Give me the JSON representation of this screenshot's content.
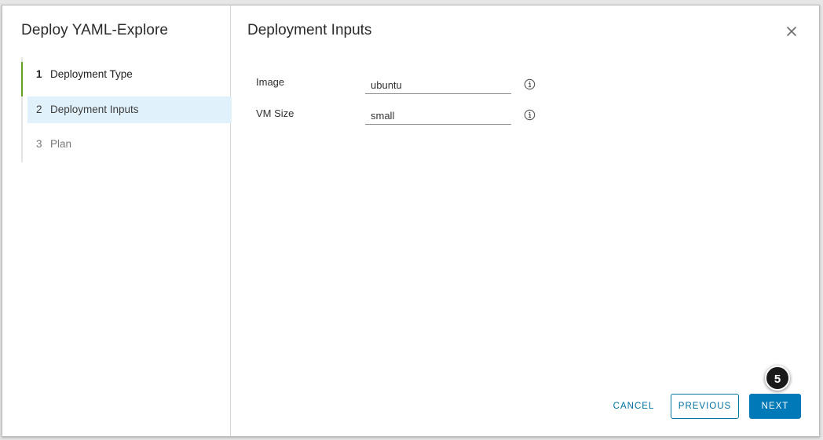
{
  "wizard": {
    "title": "Deploy YAML-Explore",
    "steps": [
      {
        "number": "1",
        "label": "Deployment Type"
      },
      {
        "number": "2",
        "label": "Deployment Inputs"
      },
      {
        "number": "3",
        "label": "Plan"
      }
    ]
  },
  "page": {
    "title": "Deployment Inputs"
  },
  "fields": [
    {
      "label": "Image",
      "value": "ubuntu"
    },
    {
      "label": "VM Size",
      "value": "small"
    }
  ],
  "footer": {
    "cancel_label": "CANCEL",
    "previous_label": "PREVIOUS",
    "next_label": "NEXT"
  },
  "callout": {
    "number": "5"
  },
  "colors": {
    "accent": "#0079b8",
    "completed_step": "#62a420",
    "active_step_bg": "#e1f1fb"
  },
  "icons": {
    "close": "close-icon",
    "info": "info-icon"
  }
}
